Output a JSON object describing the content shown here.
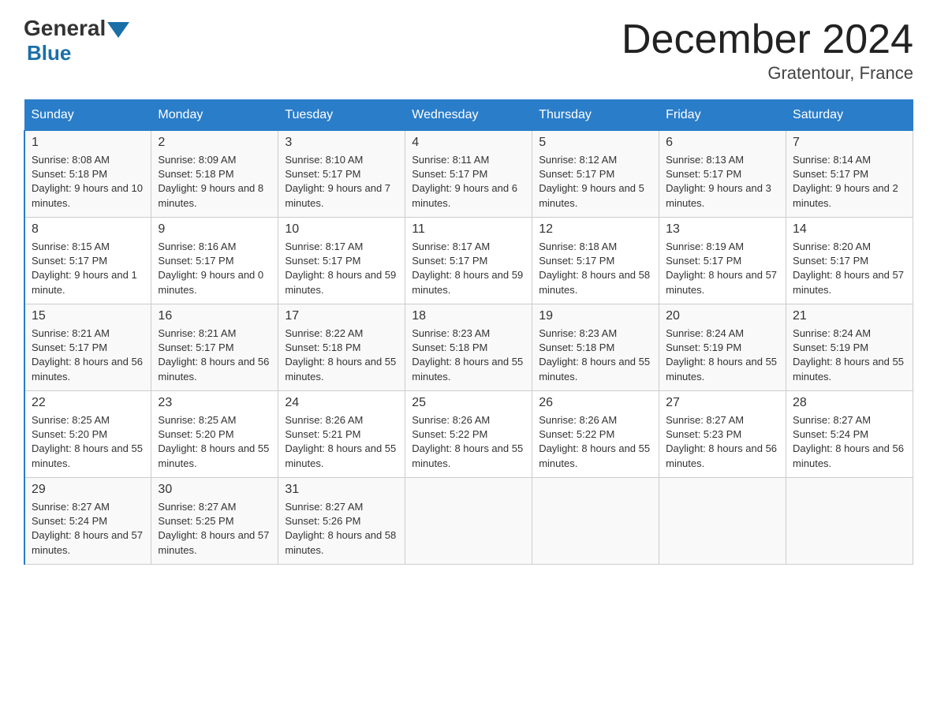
{
  "logo": {
    "general": "General",
    "blue": "Blue"
  },
  "title": {
    "month_year": "December 2024",
    "location": "Gratentour, France"
  },
  "headers": [
    "Sunday",
    "Monday",
    "Tuesday",
    "Wednesday",
    "Thursday",
    "Friday",
    "Saturday"
  ],
  "weeks": [
    [
      {
        "day": "1",
        "sunrise": "8:08 AM",
        "sunset": "5:18 PM",
        "daylight": "9 hours and 10 minutes."
      },
      {
        "day": "2",
        "sunrise": "8:09 AM",
        "sunset": "5:18 PM",
        "daylight": "9 hours and 8 minutes."
      },
      {
        "day": "3",
        "sunrise": "8:10 AM",
        "sunset": "5:17 PM",
        "daylight": "9 hours and 7 minutes."
      },
      {
        "day": "4",
        "sunrise": "8:11 AM",
        "sunset": "5:17 PM",
        "daylight": "9 hours and 6 minutes."
      },
      {
        "day": "5",
        "sunrise": "8:12 AM",
        "sunset": "5:17 PM",
        "daylight": "9 hours and 5 minutes."
      },
      {
        "day": "6",
        "sunrise": "8:13 AM",
        "sunset": "5:17 PM",
        "daylight": "9 hours and 3 minutes."
      },
      {
        "day": "7",
        "sunrise": "8:14 AM",
        "sunset": "5:17 PM",
        "daylight": "9 hours and 2 minutes."
      }
    ],
    [
      {
        "day": "8",
        "sunrise": "8:15 AM",
        "sunset": "5:17 PM",
        "daylight": "9 hours and 1 minute."
      },
      {
        "day": "9",
        "sunrise": "8:16 AM",
        "sunset": "5:17 PM",
        "daylight": "9 hours and 0 minutes."
      },
      {
        "day": "10",
        "sunrise": "8:17 AM",
        "sunset": "5:17 PM",
        "daylight": "8 hours and 59 minutes."
      },
      {
        "day": "11",
        "sunrise": "8:17 AM",
        "sunset": "5:17 PM",
        "daylight": "8 hours and 59 minutes."
      },
      {
        "day": "12",
        "sunrise": "8:18 AM",
        "sunset": "5:17 PM",
        "daylight": "8 hours and 58 minutes."
      },
      {
        "day": "13",
        "sunrise": "8:19 AM",
        "sunset": "5:17 PM",
        "daylight": "8 hours and 57 minutes."
      },
      {
        "day": "14",
        "sunrise": "8:20 AM",
        "sunset": "5:17 PM",
        "daylight": "8 hours and 57 minutes."
      }
    ],
    [
      {
        "day": "15",
        "sunrise": "8:21 AM",
        "sunset": "5:17 PM",
        "daylight": "8 hours and 56 minutes."
      },
      {
        "day": "16",
        "sunrise": "8:21 AM",
        "sunset": "5:17 PM",
        "daylight": "8 hours and 56 minutes."
      },
      {
        "day": "17",
        "sunrise": "8:22 AM",
        "sunset": "5:18 PM",
        "daylight": "8 hours and 55 minutes."
      },
      {
        "day": "18",
        "sunrise": "8:23 AM",
        "sunset": "5:18 PM",
        "daylight": "8 hours and 55 minutes."
      },
      {
        "day": "19",
        "sunrise": "8:23 AM",
        "sunset": "5:18 PM",
        "daylight": "8 hours and 55 minutes."
      },
      {
        "day": "20",
        "sunrise": "8:24 AM",
        "sunset": "5:19 PM",
        "daylight": "8 hours and 55 minutes."
      },
      {
        "day": "21",
        "sunrise": "8:24 AM",
        "sunset": "5:19 PM",
        "daylight": "8 hours and 55 minutes."
      }
    ],
    [
      {
        "day": "22",
        "sunrise": "8:25 AM",
        "sunset": "5:20 PM",
        "daylight": "8 hours and 55 minutes."
      },
      {
        "day": "23",
        "sunrise": "8:25 AM",
        "sunset": "5:20 PM",
        "daylight": "8 hours and 55 minutes."
      },
      {
        "day": "24",
        "sunrise": "8:26 AM",
        "sunset": "5:21 PM",
        "daylight": "8 hours and 55 minutes."
      },
      {
        "day": "25",
        "sunrise": "8:26 AM",
        "sunset": "5:22 PM",
        "daylight": "8 hours and 55 minutes."
      },
      {
        "day": "26",
        "sunrise": "8:26 AM",
        "sunset": "5:22 PM",
        "daylight": "8 hours and 55 minutes."
      },
      {
        "day": "27",
        "sunrise": "8:27 AM",
        "sunset": "5:23 PM",
        "daylight": "8 hours and 56 minutes."
      },
      {
        "day": "28",
        "sunrise": "8:27 AM",
        "sunset": "5:24 PM",
        "daylight": "8 hours and 56 minutes."
      }
    ],
    [
      {
        "day": "29",
        "sunrise": "8:27 AM",
        "sunset": "5:24 PM",
        "daylight": "8 hours and 57 minutes."
      },
      {
        "day": "30",
        "sunrise": "8:27 AM",
        "sunset": "5:25 PM",
        "daylight": "8 hours and 57 minutes."
      },
      {
        "day": "31",
        "sunrise": "8:27 AM",
        "sunset": "5:26 PM",
        "daylight": "8 hours and 58 minutes."
      },
      null,
      null,
      null,
      null
    ]
  ]
}
